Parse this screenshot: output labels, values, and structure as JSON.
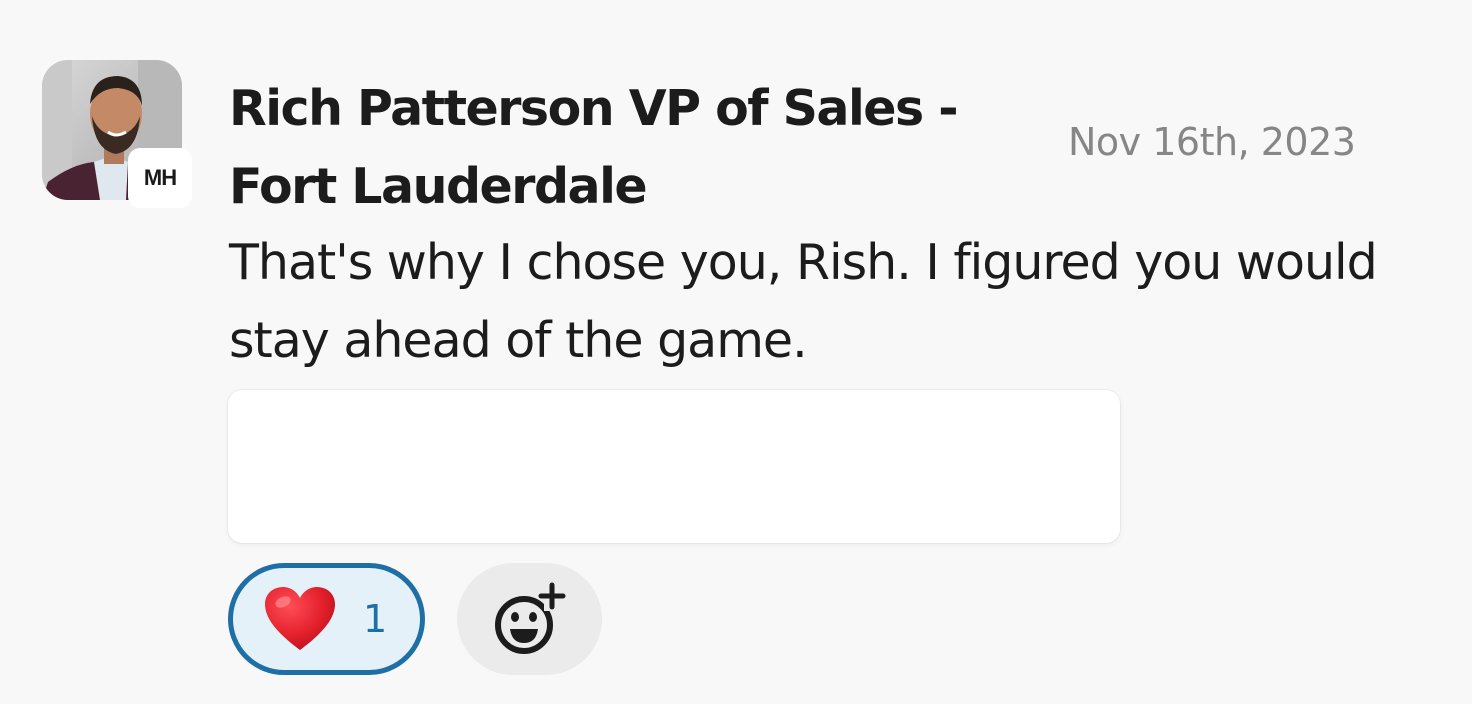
{
  "message": {
    "sender_line1": "Rich Patterson VP of Sales -",
    "sender_line2": "Fort Lauderdale",
    "timestamp": "Nov 16th, 2023",
    "text": "That's why I chose you, Rish. I figured you would stay ahead of the game.",
    "org_badge": "MH"
  },
  "reactions": [
    {
      "emoji": "heart-icon",
      "count": "1",
      "color": "#1d6fa5"
    }
  ],
  "add_reaction": {
    "icon": "add-reaction-icon"
  },
  "colors": {
    "accent": "#1d6fa5",
    "reaction_bg": "#e4f1f8",
    "timestamp": "#868686",
    "text": "#1d1c1d"
  }
}
